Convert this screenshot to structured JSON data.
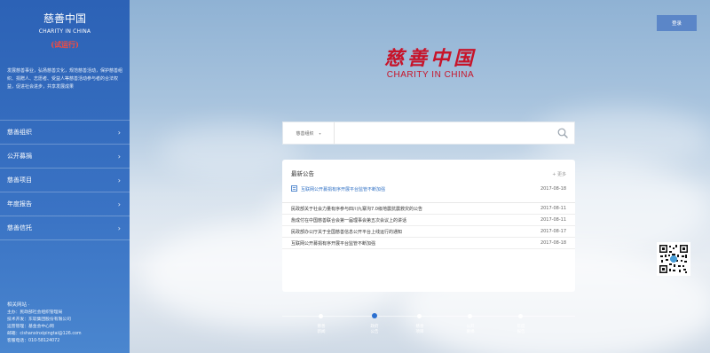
{
  "sidebar": {
    "title": "慈善中国",
    "subtitle": "CHARITY IN CHINA",
    "badge": "(试运行)",
    "description": "发展慈善事业，弘扬慈善文化，规范慈善活动，保护慈善组织、捐赠人、志愿者、受益人等慈善活动参与者的合法权益，促进社会进步，共享发展成果",
    "nav": [
      {
        "label": "慈善组织"
      },
      {
        "label": "公开募捐"
      },
      {
        "label": "慈善项目"
      },
      {
        "label": "年度报告"
      },
      {
        "label": "慈善信托"
      }
    ],
    "footer": {
      "title": "相关网站 ·",
      "lines": [
        "主办：民政部社会组织管理局",
        "技术开发：东软集团股份有限公司",
        "运营管理：基金会中心网",
        "邮箱：cishanxinxipingtai@126.com",
        "客服电话：010-58124072"
      ]
    }
  },
  "header": {
    "login_label": "登录"
  },
  "brand": {
    "cn": "慈善中国",
    "en": "CHARITY IN CHINA"
  },
  "search": {
    "category": "慈善组织",
    "value": ""
  },
  "notices": {
    "title": "最新公告",
    "more": "+ 更多",
    "featured": {
      "text": "互联网公开募捐有序开展平台监管不断加强",
      "date": "2017-08-18"
    },
    "items": [
      {
        "text": "民政部关于社会力量有序参与四川九寨沟7.0级地震抗震救灾的公告",
        "date": "2017-08-11"
      },
      {
        "text": "詹成付在中国慈善联合会第一届理事会第五次会议上的讲话",
        "date": "2017-08-11"
      },
      {
        "text": "民政部办公厅关于全国慈善信息公开平台上线运行的通知",
        "date": "2017-08-17"
      },
      {
        "text": "互联网公开募捐有序开展平台监管不断加强",
        "date": "2017-08-18"
      }
    ]
  },
  "timeline": [
    {
      "label": "慈善\n新闻",
      "active": false
    },
    {
      "label": "政府\n公告",
      "active": true
    },
    {
      "label": "慈善\n项目",
      "active": false
    },
    {
      "label": "公开\n募捐",
      "active": false
    },
    {
      "label": "年度\n报告",
      "active": false
    }
  ],
  "colors": {
    "brand_red": "#c7142a",
    "sidebar_blue": "#2c62b6",
    "link_blue": "#2e6fc4"
  }
}
